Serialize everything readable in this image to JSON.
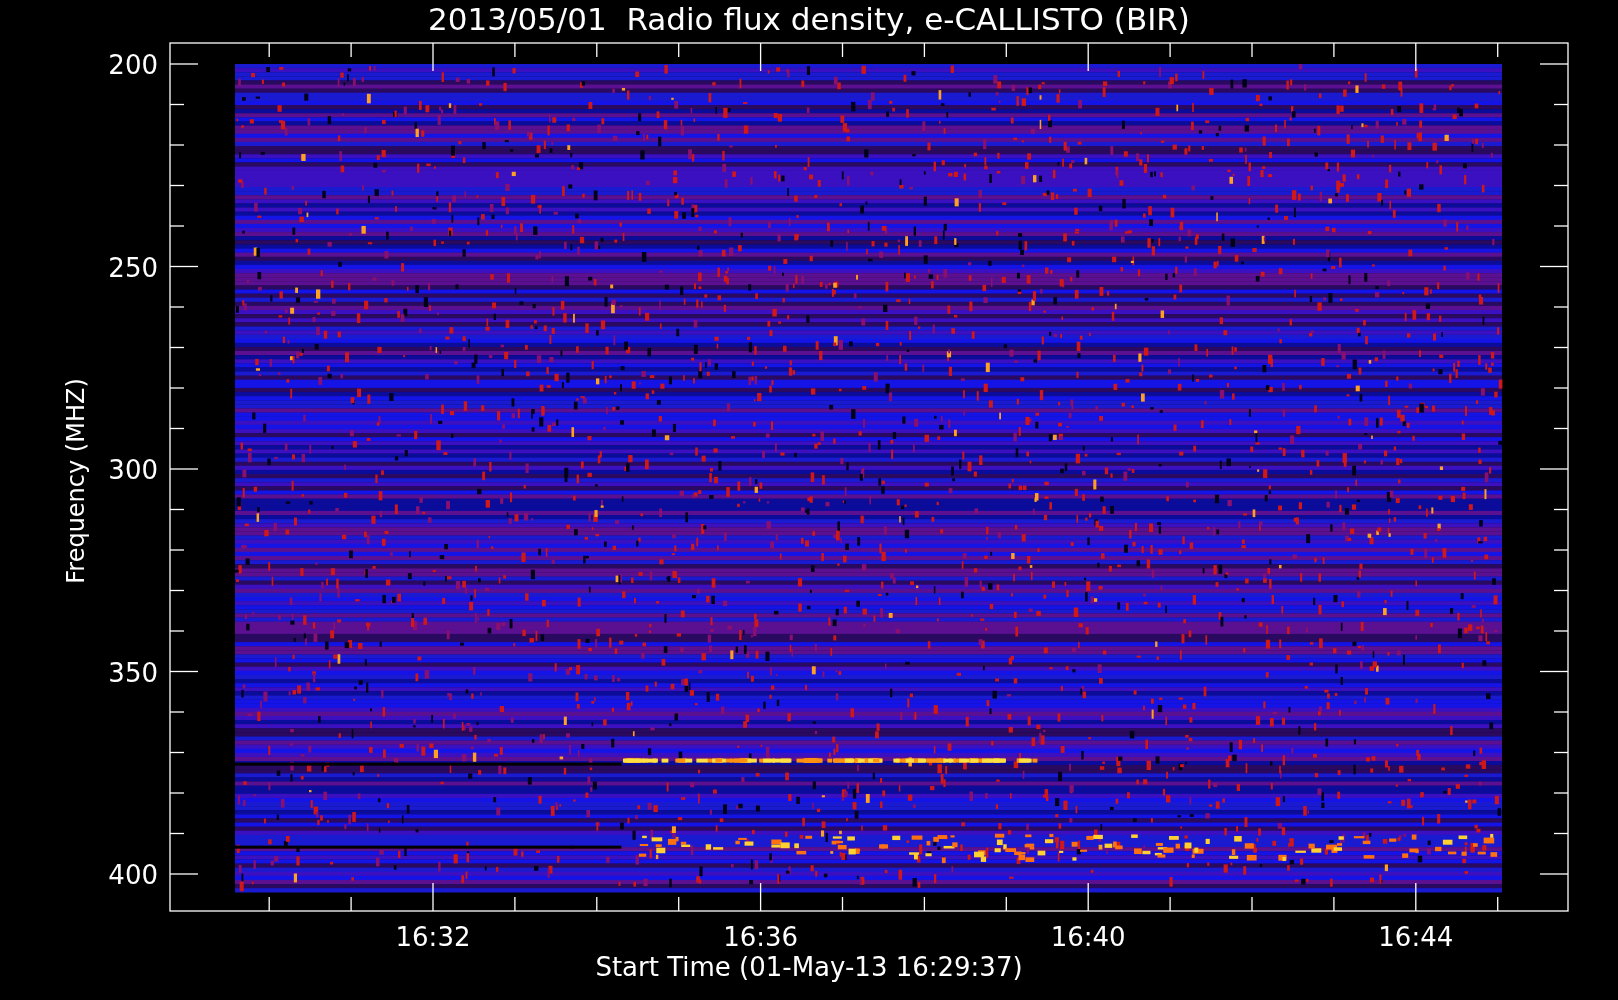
{
  "title": "2013/05/01  Radio flux density, e-CALLISTO (BIR)",
  "y_axis": {
    "label": "Frequency (MHZ)",
    "ticks": [
      "200",
      "250",
      "300",
      "350",
      "400"
    ]
  },
  "x_axis": {
    "label": "Start Time (01-May-13 16:29:37)",
    "ticks": [
      "16:32",
      "16:36",
      "16:40",
      "16:44"
    ]
  }
}
